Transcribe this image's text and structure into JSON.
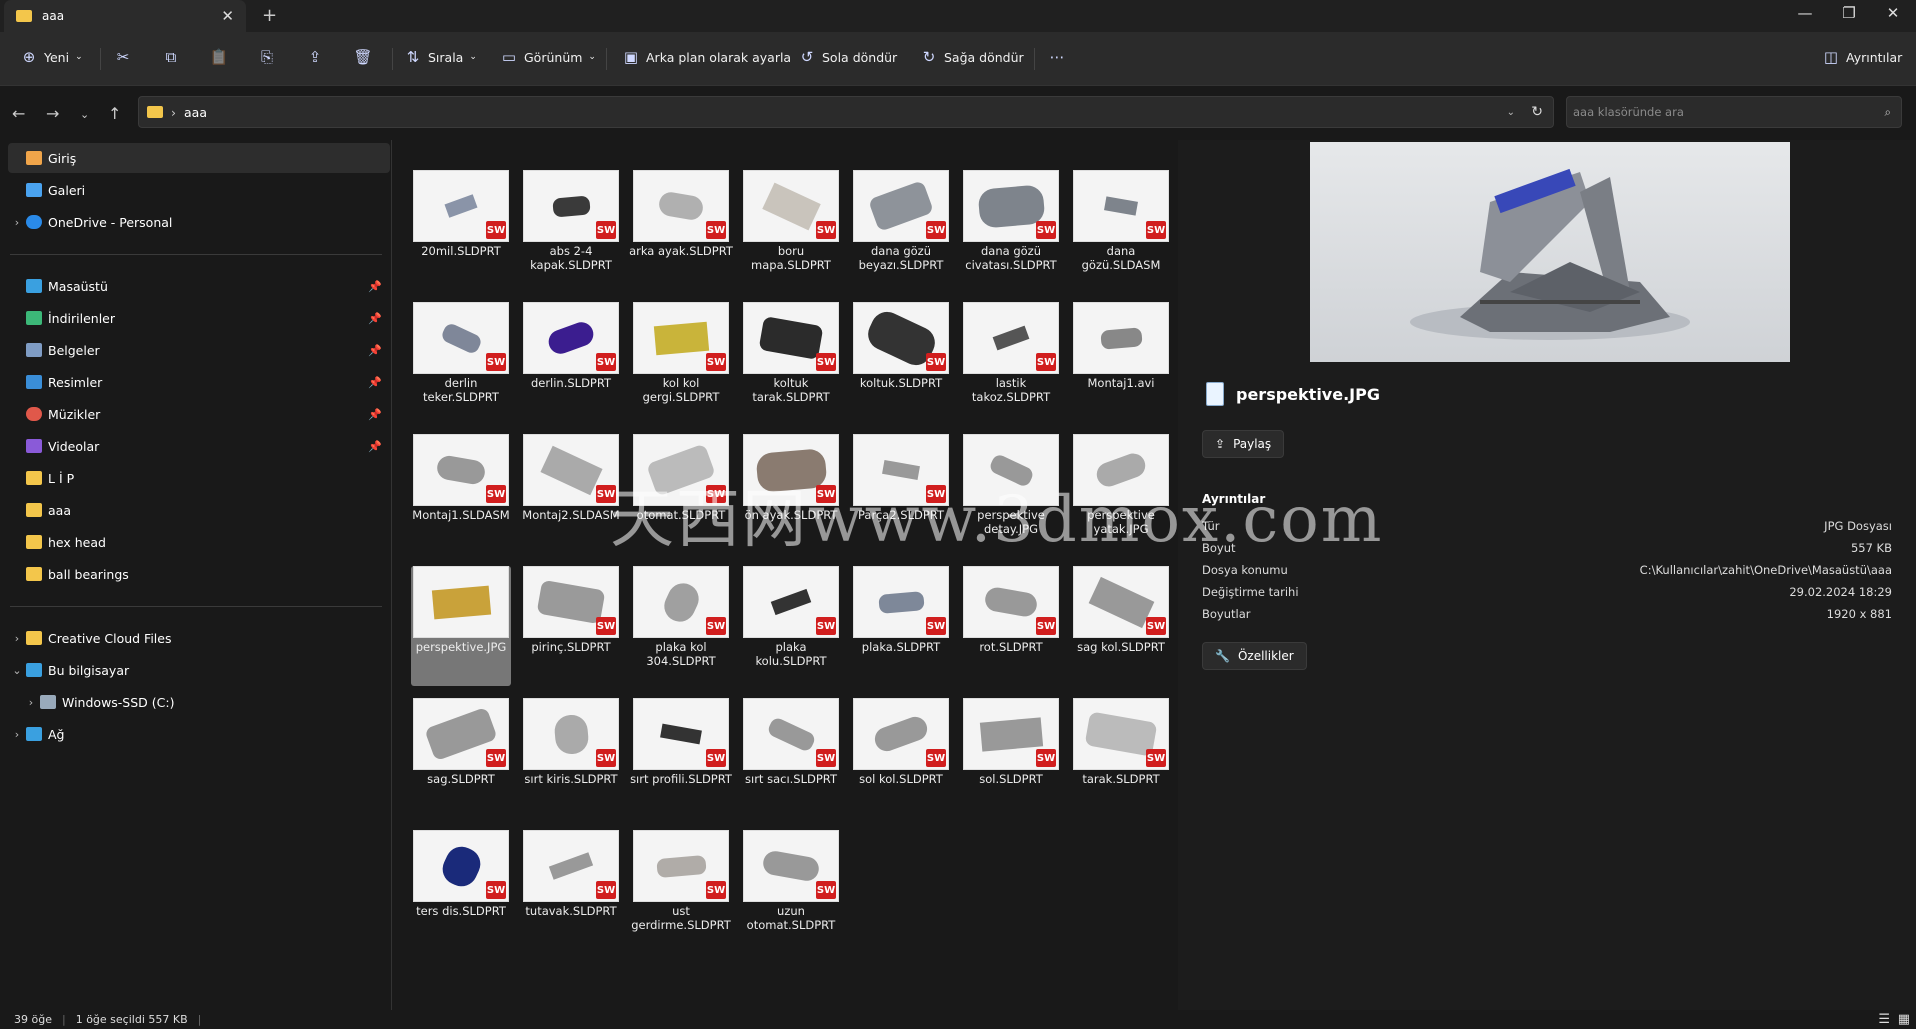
{
  "window": {
    "tab_title": "aaa"
  },
  "toolbar": {
    "new": "Yeni",
    "sort": "Sırala",
    "view": "Görünüm",
    "set_background": "Arka plan olarak ayarla",
    "rotate_left": "Sola döndür",
    "rotate_right": "Sağa döndür",
    "details": "Ayrıntılar"
  },
  "address": {
    "path": "aaa",
    "search_placeholder": "aaa klasöründe ara"
  },
  "sidebar": {
    "top": [
      {
        "label": "Giriş"
      },
      {
        "label": "Galeri"
      },
      {
        "label": "OneDrive - Personal"
      }
    ],
    "pinned": [
      {
        "label": "Masaüstü"
      },
      {
        "label": "İndirilenler"
      },
      {
        "label": "Belgeler"
      },
      {
        "label": "Resimler"
      },
      {
        "label": "Müzikler"
      },
      {
        "label": "Videolar"
      }
    ],
    "folders": [
      {
        "label": "L İ P"
      },
      {
        "label": "aaa"
      },
      {
        "label": "hex head"
      },
      {
        "label": "ball bearings"
      }
    ],
    "bottom": [
      {
        "label": "Creative Cloud Files"
      },
      {
        "label": "Bu bilgisayar"
      },
      {
        "label": "Windows-SSD (C:)"
      },
      {
        "label": "Ağ"
      }
    ]
  },
  "files": [
    {
      "name": "20mil.SLDPRT"
    },
    {
      "name": "abs 2-4 kapak.SLDPRT"
    },
    {
      "name": "arka ayak.SLDPRT"
    },
    {
      "name": "boru mapa.SLDPRT"
    },
    {
      "name": "dana gözü beyazı.SLDPRT"
    },
    {
      "name": "dana gözü civatası.SLDPRT"
    },
    {
      "name": "dana gözü.SLDASM"
    },
    {
      "name": "derlin teker.SLDPRT"
    },
    {
      "name": "derlin.SLDPRT"
    },
    {
      "name": "kol kol gergi.SLDPRT"
    },
    {
      "name": "koltuk tarak.SLDPRT"
    },
    {
      "name": "koltuk.SLDPRT"
    },
    {
      "name": "lastik takoz.SLDPRT"
    },
    {
      "name": "Montaj1.avi"
    },
    {
      "name": "Montaj1.SLDASM"
    },
    {
      "name": "Montaj2.SLDASM"
    },
    {
      "name": "otomat.SLDPRT"
    },
    {
      "name": "ön ayak.SLDPRT"
    },
    {
      "name": "Parça2.SLDPRT"
    },
    {
      "name": "perspektive detay.JPG"
    },
    {
      "name": "perspektive yatak.JPG"
    },
    {
      "name": "perspektive.JPG"
    },
    {
      "name": "pirinç.SLDPRT"
    },
    {
      "name": "plaka kol 304.SLDPRT"
    },
    {
      "name": "plaka kolu.SLDPRT"
    },
    {
      "name": "plaka.SLDPRT"
    },
    {
      "name": "rot.SLDPRT"
    },
    {
      "name": "sag kol.SLDPRT"
    },
    {
      "name": "sag.SLDPRT"
    },
    {
      "name": "sırt kiris.SLDPRT"
    },
    {
      "name": "sırt profili.SLDPRT"
    },
    {
      "name": "sırt sacı.SLDPRT"
    },
    {
      "name": "sol kol.SLDPRT"
    },
    {
      "name": "sol.SLDPRT"
    },
    {
      "name": "tarak.SLDPRT"
    },
    {
      "name": "ters dis.SLDPRT"
    },
    {
      "name": "tutavak.SLDPRT"
    },
    {
      "name": "ust gerdirme.SLDPRT"
    },
    {
      "name": "uzun otomat.SLDPRT"
    }
  ],
  "sw_badge": "SW",
  "preview": {
    "filename": "perspektive.JPG",
    "share": "Paylaş",
    "details_heading": "Ayrıntılar",
    "properties": "Özellikler",
    "rows": [
      {
        "k": "Tür",
        "v": "JPG Dosyası"
      },
      {
        "k": "Boyut",
        "v": "557 KB"
      },
      {
        "k": "Dosya konumu",
        "v": "C:\\Kullanıcılar\\zahit\\OneDrive\\Masaüstü\\aaa"
      },
      {
        "k": "Değiştirme tarihi",
        "v": "29.02.2024 18:29"
      },
      {
        "k": "Boyutlar",
        "v": "1920 x 881"
      }
    ]
  },
  "status": {
    "count": "39 öğe",
    "selected": "1 öğe seçildi  557 KB"
  },
  "watermark": "天西网www.3dmox.com"
}
